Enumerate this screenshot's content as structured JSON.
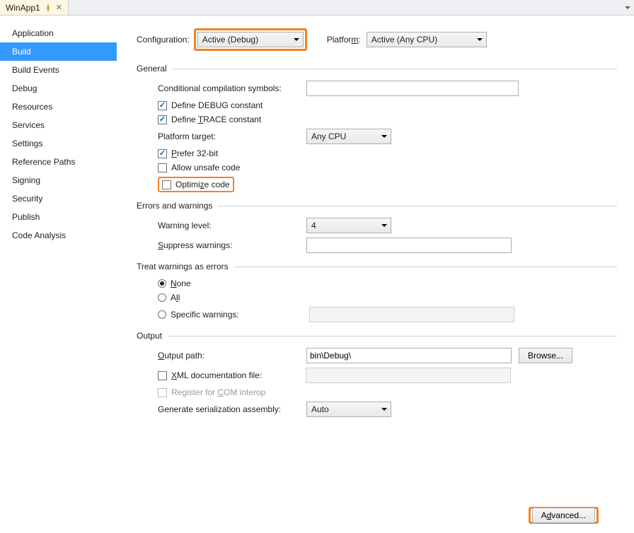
{
  "tab": {
    "title": "WinApp1"
  },
  "sidebar": {
    "items": [
      {
        "label": "Application"
      },
      {
        "label": "Build"
      },
      {
        "label": "Build Events"
      },
      {
        "label": "Debug"
      },
      {
        "label": "Resources"
      },
      {
        "label": "Services"
      },
      {
        "label": "Settings"
      },
      {
        "label": "Reference Paths"
      },
      {
        "label": "Signing"
      },
      {
        "label": "Security"
      },
      {
        "label": "Publish"
      },
      {
        "label": "Code Analysis"
      }
    ],
    "activeIndex": 1
  },
  "top": {
    "configuration_label": "Configuration:",
    "configuration_value": "Active (Debug)",
    "platform_label": "Platform:",
    "platform_value": "Active (Any CPU)"
  },
  "general": {
    "header": "General",
    "cond_symbols_label": "Conditional compilation symbols:",
    "cond_symbols_value": "",
    "define_debug_label": "Define DEBUG constant",
    "define_trace_label": "Define TRACE constant",
    "platform_target_label": "Platform target:",
    "platform_target_value": "Any CPU",
    "prefer_32_label": "Prefer 32-bit",
    "allow_unsafe_label": "Allow unsafe code",
    "optimize_label": "Optimize code"
  },
  "errors": {
    "header": "Errors and warnings",
    "warning_level_label": "Warning level:",
    "warning_level_value": "4",
    "suppress_label": "Suppress warnings:",
    "suppress_value": ""
  },
  "treat": {
    "header": "Treat warnings as errors",
    "none": "None",
    "all": "All",
    "specific_label": "Specific warnings:",
    "specific_value": ""
  },
  "output": {
    "header": "Output",
    "path_label": "Output path:",
    "path_value": "bin\\Debug\\",
    "browse": "Browse...",
    "xml_doc_label": "XML documentation file:",
    "xml_doc_value": "",
    "com_label": "Register for COM interop",
    "gen_serial_label": "Generate serialization assembly:",
    "gen_serial_value": "Auto"
  },
  "advanced_button": "Advanced..."
}
